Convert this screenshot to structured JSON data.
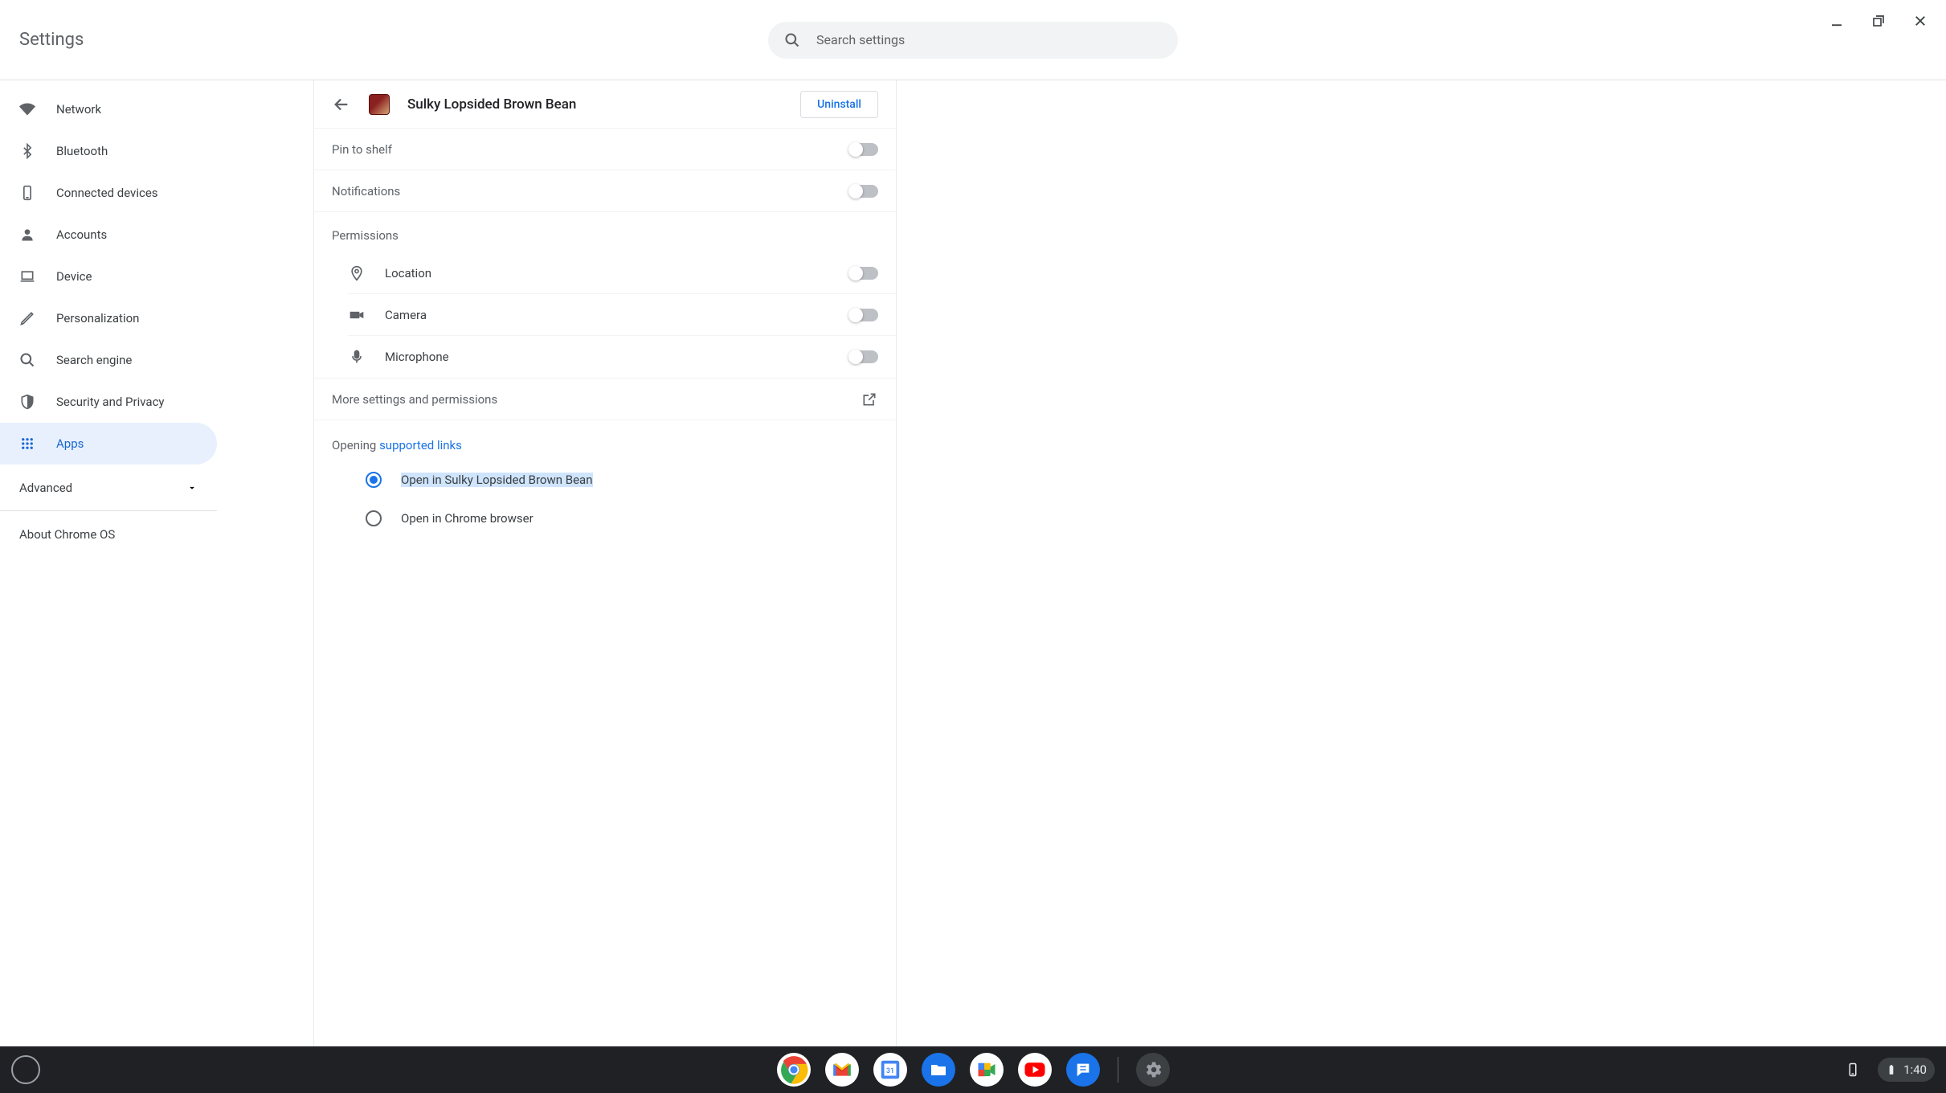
{
  "header": {
    "title": "Settings",
    "search_placeholder": "Search settings"
  },
  "sidebar": {
    "items": [
      {
        "label": "Network"
      },
      {
        "label": "Bluetooth"
      },
      {
        "label": "Connected devices"
      },
      {
        "label": "Accounts"
      },
      {
        "label": "Device"
      },
      {
        "label": "Personalization"
      },
      {
        "label": "Search engine"
      },
      {
        "label": "Security and Privacy"
      },
      {
        "label": "Apps"
      }
    ],
    "advanced_label": "Advanced",
    "about_label": "About Chrome OS"
  },
  "detail": {
    "app_name": "Sulky Lopsided Brown Bean",
    "uninstall_label": "Uninstall",
    "pin_label": "Pin to shelf",
    "notifications_label": "Notifications",
    "permissions_heading": "Permissions",
    "perms": [
      {
        "label": "Location"
      },
      {
        "label": "Camera"
      },
      {
        "label": "Microphone"
      }
    ],
    "more_label": "More settings and permissions",
    "opening_prefix": "Opening ",
    "opening_link": "supported links",
    "radio_open_app": "Open in Sulky Lopsided Brown Bean",
    "radio_open_browser": "Open in Chrome browser"
  },
  "shelf": {
    "time": "1:40"
  }
}
